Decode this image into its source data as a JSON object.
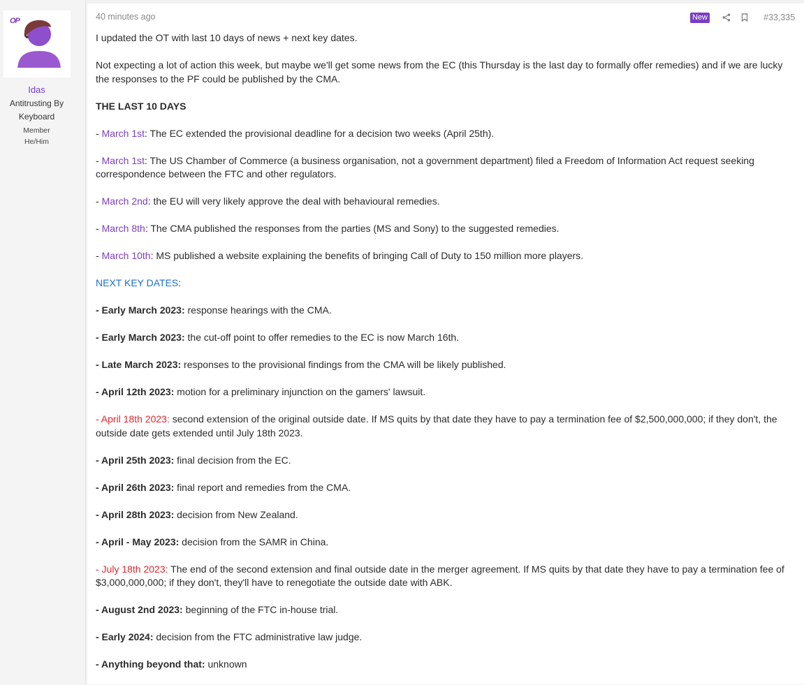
{
  "user": {
    "op_badge": "OP",
    "name": "Idas",
    "title": "Antitrusting By Keyboard",
    "role": "Member",
    "pronouns": "He/Him"
  },
  "post": {
    "time": "40 minutes ago",
    "badge": "New",
    "number": "#33,335",
    "intro1": "I updated the OT with last 10 days of news + next key dates.",
    "intro2": "Not expecting a lot of action this week, but maybe we'll get some news from the EC (this Thursday is the last day to formally offer remedies) and if we are lucky the responses to the PF could be published by the CMA.",
    "last10_heading": "THE LAST 10 DAYS",
    "news": [
      {
        "dash": "- ",
        "date": "March 1st",
        "text": ": The EC extended the provisional deadline for a decision two weeks (April 25th)."
      },
      {
        "dash": "- ",
        "date": "March 1st",
        "text": ": The US Chamber of Commerce (a business organisation, not a government department) filed a Freedom of Information Act request seeking correspondence between the FTC and other regulators."
      },
      {
        "dash": "- ",
        "date": "March 2nd",
        "text": ": the EU will very likely approve the deal with behavioural remedies."
      },
      {
        "dash": "- ",
        "date": "March 8th",
        "text": ": The CMA published the responses from the parties (MS and Sony) to the suggested remedies."
      },
      {
        "dash": "- ",
        "date": "March 10th",
        "text": ": MS published a website explaining the benefits of bringing Call of Duty to 150 million more players."
      }
    ],
    "next_heading": "NEXT KEY DATES",
    "next_heading_colon": ":",
    "key_dates": [
      {
        "date": "- Early March 2023:",
        "text": " response hearings with the CMA."
      },
      {
        "date": "- Early March 2023:",
        "text": " the cut-off point to offer remedies to the EC is now March 16th."
      },
      {
        "date": "- Late March 2023:",
        "text": " responses to the provisional findings from the CMA will be likely published."
      },
      {
        "date": "- April 12th 2023:",
        "text": " motion for a preliminary injunction on the gamers' lawsuit."
      },
      {
        "date": "- April 18th 2023:",
        "text": " second extension of the original outside date. If MS quits by that date they have to pay a termination fee of $2,500,000,000; if they don't, the outside date gets extended until July 18th 2023."
      },
      {
        "date": "- April 25th 2023:",
        "text": " final decision from the EC."
      },
      {
        "date": "- April 26th 2023:",
        "text": " final report and remedies from the CMA."
      },
      {
        "date": "- April 28th 2023:",
        "text": " decision from New Zealand."
      },
      {
        "date": "- April - May 2023:",
        "text": " decision from the SAMR in China."
      },
      {
        "date": "- July 18th 2023:",
        "text": " The end of the second extension and final outside date in the merger agreement. If MS quits by that date they have to pay a termination fee of $3,000,000,000; if they don't, they'll have to renegotiate the outside date with ABK."
      },
      {
        "date": "- August 2nd 2023:",
        "text": " beginning of the FTC in-house trial."
      },
      {
        "date": "- Early 2024:",
        "text": " decision from the FTC administrative law judge."
      },
      {
        "date": "- Anything beyond that:",
        "text": " unknown"
      }
    ]
  },
  "colors": {
    "accent_purple": "#7a3fc1",
    "heading_blue": "#1a6fd1",
    "alert_red": "#e0262b"
  },
  "icons": [
    "share-icon",
    "bookmark-icon"
  ]
}
